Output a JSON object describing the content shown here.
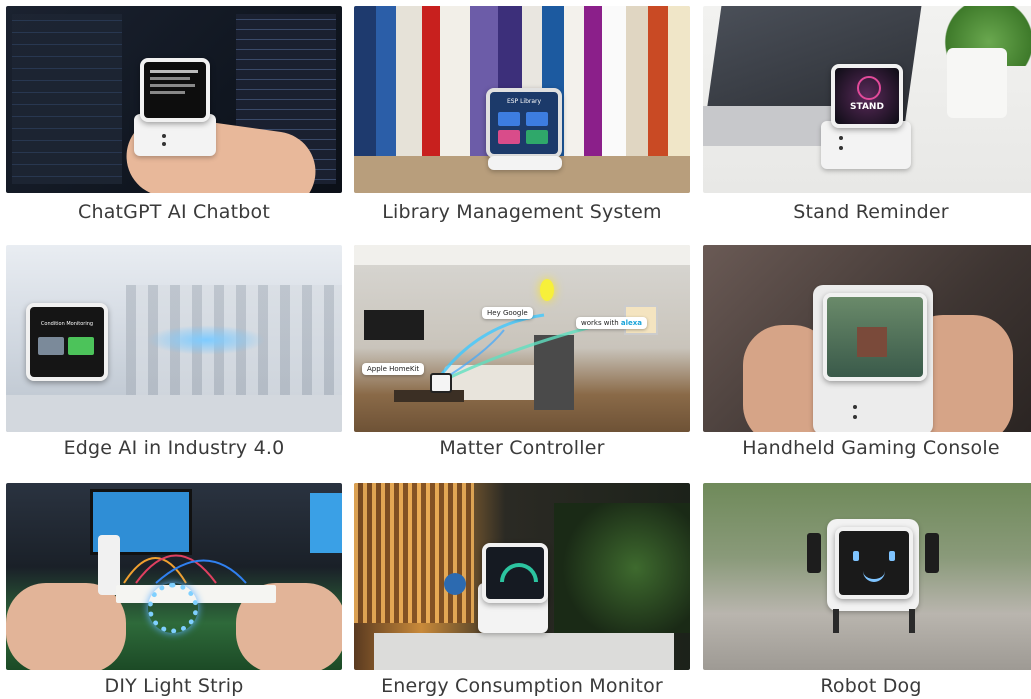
{
  "cards": [
    {
      "caption": "ChatGPT AI Chatbot"
    },
    {
      "caption": "Library Management System"
    },
    {
      "caption": "Stand Reminder"
    },
    {
      "caption": "Edge AI in Industry 4.0"
    },
    {
      "caption": "Matter Controller"
    },
    {
      "caption": "Handheld Gaming Console"
    },
    {
      "caption": "DIY Light Strip"
    },
    {
      "caption": "Energy Consumption Monitor"
    },
    {
      "caption": "Robot Dog"
    }
  ],
  "screens": {
    "stand": "STAND",
    "condition": "Condition Monitoring",
    "library": "ESP Library",
    "hey_google": "Hey Google",
    "works_with": "works with",
    "alexa": "alexa",
    "apple_homekit": "Apple HomeKit"
  }
}
